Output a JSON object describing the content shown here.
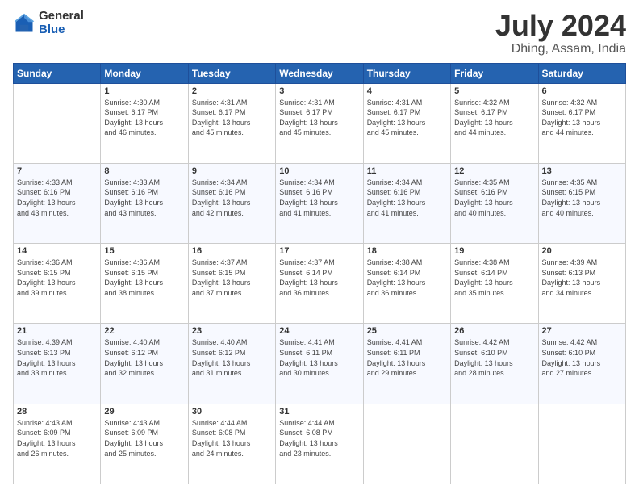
{
  "header": {
    "logo_general": "General",
    "logo_blue": "Blue",
    "title": "July 2024",
    "location": "Dhing, Assam, India"
  },
  "columns": [
    "Sunday",
    "Monday",
    "Tuesday",
    "Wednesday",
    "Thursday",
    "Friday",
    "Saturday"
  ],
  "weeks": [
    [
      {
        "day": "",
        "info": ""
      },
      {
        "day": "1",
        "info": "Sunrise: 4:30 AM\nSunset: 6:17 PM\nDaylight: 13 hours\nand 46 minutes."
      },
      {
        "day": "2",
        "info": "Sunrise: 4:31 AM\nSunset: 6:17 PM\nDaylight: 13 hours\nand 45 minutes."
      },
      {
        "day": "3",
        "info": "Sunrise: 4:31 AM\nSunset: 6:17 PM\nDaylight: 13 hours\nand 45 minutes."
      },
      {
        "day": "4",
        "info": "Sunrise: 4:31 AM\nSunset: 6:17 PM\nDaylight: 13 hours\nand 45 minutes."
      },
      {
        "day": "5",
        "info": "Sunrise: 4:32 AM\nSunset: 6:17 PM\nDaylight: 13 hours\nand 44 minutes."
      },
      {
        "day": "6",
        "info": "Sunrise: 4:32 AM\nSunset: 6:17 PM\nDaylight: 13 hours\nand 44 minutes."
      }
    ],
    [
      {
        "day": "7",
        "info": "Sunrise: 4:33 AM\nSunset: 6:16 PM\nDaylight: 13 hours\nand 43 minutes."
      },
      {
        "day": "8",
        "info": "Sunrise: 4:33 AM\nSunset: 6:16 PM\nDaylight: 13 hours\nand 43 minutes."
      },
      {
        "day": "9",
        "info": "Sunrise: 4:34 AM\nSunset: 6:16 PM\nDaylight: 13 hours\nand 42 minutes."
      },
      {
        "day": "10",
        "info": "Sunrise: 4:34 AM\nSunset: 6:16 PM\nDaylight: 13 hours\nand 41 minutes."
      },
      {
        "day": "11",
        "info": "Sunrise: 4:34 AM\nSunset: 6:16 PM\nDaylight: 13 hours\nand 41 minutes."
      },
      {
        "day": "12",
        "info": "Sunrise: 4:35 AM\nSunset: 6:16 PM\nDaylight: 13 hours\nand 40 minutes."
      },
      {
        "day": "13",
        "info": "Sunrise: 4:35 AM\nSunset: 6:15 PM\nDaylight: 13 hours\nand 40 minutes."
      }
    ],
    [
      {
        "day": "14",
        "info": "Sunrise: 4:36 AM\nSunset: 6:15 PM\nDaylight: 13 hours\nand 39 minutes."
      },
      {
        "day": "15",
        "info": "Sunrise: 4:36 AM\nSunset: 6:15 PM\nDaylight: 13 hours\nand 38 minutes."
      },
      {
        "day": "16",
        "info": "Sunrise: 4:37 AM\nSunset: 6:15 PM\nDaylight: 13 hours\nand 37 minutes."
      },
      {
        "day": "17",
        "info": "Sunrise: 4:37 AM\nSunset: 6:14 PM\nDaylight: 13 hours\nand 36 minutes."
      },
      {
        "day": "18",
        "info": "Sunrise: 4:38 AM\nSunset: 6:14 PM\nDaylight: 13 hours\nand 36 minutes."
      },
      {
        "day": "19",
        "info": "Sunrise: 4:38 AM\nSunset: 6:14 PM\nDaylight: 13 hours\nand 35 minutes."
      },
      {
        "day": "20",
        "info": "Sunrise: 4:39 AM\nSunset: 6:13 PM\nDaylight: 13 hours\nand 34 minutes."
      }
    ],
    [
      {
        "day": "21",
        "info": "Sunrise: 4:39 AM\nSunset: 6:13 PM\nDaylight: 13 hours\nand 33 minutes."
      },
      {
        "day": "22",
        "info": "Sunrise: 4:40 AM\nSunset: 6:12 PM\nDaylight: 13 hours\nand 32 minutes."
      },
      {
        "day": "23",
        "info": "Sunrise: 4:40 AM\nSunset: 6:12 PM\nDaylight: 13 hours\nand 31 minutes."
      },
      {
        "day": "24",
        "info": "Sunrise: 4:41 AM\nSunset: 6:11 PM\nDaylight: 13 hours\nand 30 minutes."
      },
      {
        "day": "25",
        "info": "Sunrise: 4:41 AM\nSunset: 6:11 PM\nDaylight: 13 hours\nand 29 minutes."
      },
      {
        "day": "26",
        "info": "Sunrise: 4:42 AM\nSunset: 6:10 PM\nDaylight: 13 hours\nand 28 minutes."
      },
      {
        "day": "27",
        "info": "Sunrise: 4:42 AM\nSunset: 6:10 PM\nDaylight: 13 hours\nand 27 minutes."
      }
    ],
    [
      {
        "day": "28",
        "info": "Sunrise: 4:43 AM\nSunset: 6:09 PM\nDaylight: 13 hours\nand 26 minutes."
      },
      {
        "day": "29",
        "info": "Sunrise: 4:43 AM\nSunset: 6:09 PM\nDaylight: 13 hours\nand 25 minutes."
      },
      {
        "day": "30",
        "info": "Sunrise: 4:44 AM\nSunset: 6:08 PM\nDaylight: 13 hours\nand 24 minutes."
      },
      {
        "day": "31",
        "info": "Sunrise: 4:44 AM\nSunset: 6:08 PM\nDaylight: 13 hours\nand 23 minutes."
      },
      {
        "day": "",
        "info": ""
      },
      {
        "day": "",
        "info": ""
      },
      {
        "day": "",
        "info": ""
      }
    ]
  ]
}
